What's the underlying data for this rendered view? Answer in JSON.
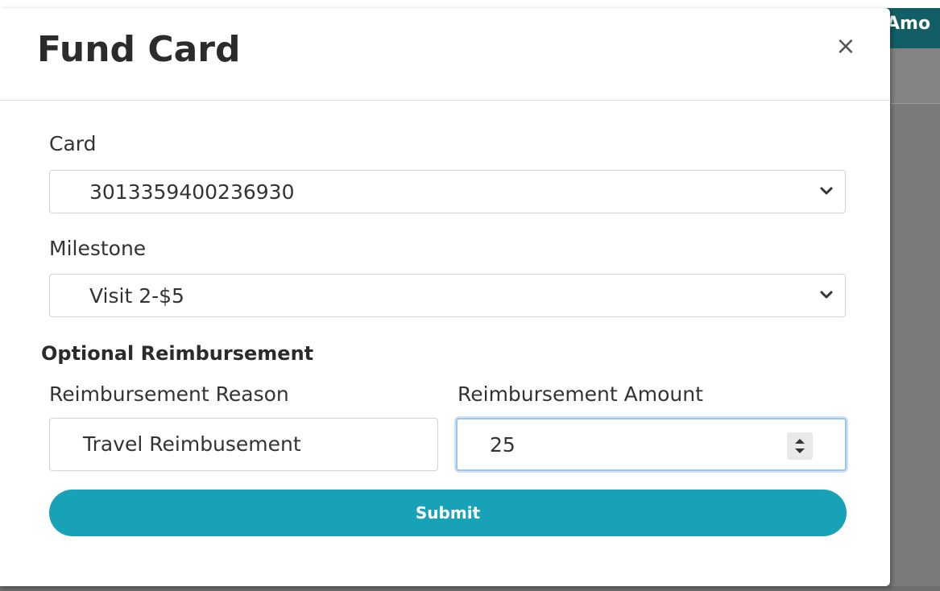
{
  "background": {
    "header_button_label": "Amo"
  },
  "modal": {
    "title": "Fund Card",
    "close_label": "×",
    "card": {
      "label": "Card",
      "value": "3013359400236930"
    },
    "milestone": {
      "label": "Milestone",
      "value": "Visit 2-$5"
    },
    "optional_heading": "Optional Reimbursement",
    "reason": {
      "label": "Reimbursement Reason",
      "value": "Travel Reimbusement"
    },
    "amount": {
      "label": "Reimbursement Amount",
      "value": "25"
    },
    "submit_label": "Submit"
  },
  "colors": {
    "accent": "#17a2b8",
    "header_button": "#115e67",
    "overlay": "#7a7a7a"
  },
  "icons": [
    "close-icon",
    "chevron-down-icon",
    "spinner-arrows-icon"
  ]
}
